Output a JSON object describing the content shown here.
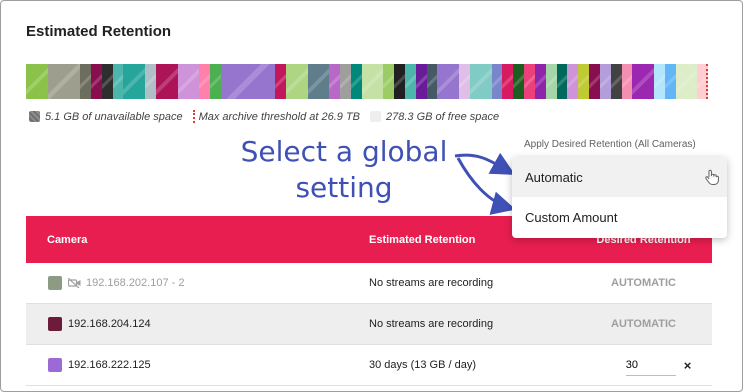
{
  "title": "Estimated Retention",
  "storage_bar": {
    "segments": [
      {
        "color": "#8bc34a",
        "flex": 2
      },
      {
        "color": "#9e9e8e",
        "flex": 3
      },
      {
        "color": "#6d6d5d",
        "flex": 1
      },
      {
        "color": "#880e4f",
        "flex": 1
      },
      {
        "color": "#2e2e2e",
        "flex": 1
      },
      {
        "color": "#4db6ac",
        "flex": 1
      },
      {
        "color": "#26a69a",
        "flex": 2
      },
      {
        "color": "#b0bec5",
        "flex": 1
      },
      {
        "color": "#ad1457",
        "flex": 2
      },
      {
        "color": "#ce93d8",
        "flex": 2
      },
      {
        "color": "#ff80ab",
        "flex": 1
      },
      {
        "color": "#4caf50",
        "flex": 1
      },
      {
        "color": "#9575cd",
        "flex": 5
      },
      {
        "color": "#c2185b",
        "flex": 1
      },
      {
        "color": "#aed581",
        "flex": 2
      },
      {
        "color": "#607d8b",
        "flex": 2
      },
      {
        "color": "#ba68c8",
        "flex": 1
      },
      {
        "color": "#9e9e9e",
        "flex": 1
      },
      {
        "color": "#00897b",
        "flex": 1
      },
      {
        "color": "#c5e1a5",
        "flex": 2
      },
      {
        "color": "#9ccc65",
        "flex": 1
      },
      {
        "color": "#212121",
        "flex": 1
      },
      {
        "color": "#4db6ac",
        "flex": 1
      },
      {
        "color": "#6a1b9a",
        "flex": 1
      },
      {
        "color": "#455a64",
        "flex": 1
      },
      {
        "color": "#9575cd",
        "flex": 2
      },
      {
        "color": "#e1bee7",
        "flex": 1
      },
      {
        "color": "#80cbc4",
        "flex": 2
      },
      {
        "color": "#7986cb",
        "flex": 1
      },
      {
        "color": "#d81b60",
        "flex": 1
      },
      {
        "color": "#1b5e20",
        "flex": 1
      },
      {
        "color": "#ec407a",
        "flex": 1
      },
      {
        "color": "#8e24aa",
        "flex": 1
      },
      {
        "color": "#a5d6a7",
        "flex": 1
      },
      {
        "color": "#00695c",
        "flex": 1
      },
      {
        "color": "#ce93d8",
        "flex": 1
      },
      {
        "color": "#c0ca33",
        "flex": 1
      },
      {
        "color": "#880e4f",
        "flex": 1
      },
      {
        "color": "#b39ddb",
        "flex": 1
      },
      {
        "color": "#424242",
        "flex": 1
      },
      {
        "color": "#f48fb1",
        "flex": 1
      },
      {
        "color": "#9c27b0",
        "flex": 2
      },
      {
        "color": "#b3e5fc",
        "flex": 1
      },
      {
        "color": "#64b5f6",
        "flex": 1
      },
      {
        "color": "#dcedc8",
        "flex": 2
      },
      {
        "color": "#ffcdd2",
        "flex": 1
      }
    ]
  },
  "legend": {
    "unavailable": "5.1 GB of unavailable space",
    "threshold": "Max archive threshold at 26.9 TB",
    "free": "278.3 GB of free space"
  },
  "apply_label": "Apply Desired Retention (All Cameras)",
  "annotation": {
    "line1": "Select a global",
    "line2": "setting",
    "color": "#3f51b5"
  },
  "menu": {
    "options": [
      "Automatic",
      "Custom Amount"
    ],
    "cursor_icon": "hand-pointer-icon"
  },
  "table": {
    "headers": {
      "camera": "Camera",
      "estimated": "Estimated Retention",
      "desired": "Desired Retention"
    },
    "header_color": "#e91e50",
    "rows": [
      {
        "swatch": "#8d9b84",
        "name": "192.168.202.107 - 2",
        "muted": true,
        "icon": "camera-off-icon",
        "estimated": "No streams are recording",
        "desired": "AUTOMATIC"
      },
      {
        "swatch": "#6d1b3a",
        "name": "192.168.204.124",
        "muted": false,
        "estimated": "No streams are recording",
        "desired": "AUTOMATIC"
      },
      {
        "swatch": "#9c6ad6",
        "name": "192.168.222.125",
        "muted": false,
        "estimated": "30 days (13 GB / day)",
        "desired_value": "30",
        "clear": "×"
      }
    ]
  }
}
